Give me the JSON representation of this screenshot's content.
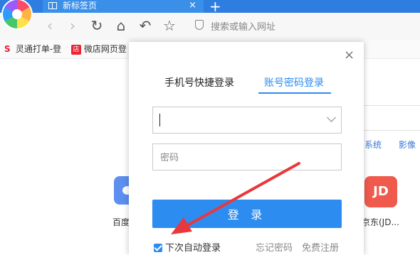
{
  "browser": {
    "tab_title": "新标签页",
    "tab_close": "×",
    "new_tab": "+",
    "address_placeholder": "搜索或输入网址",
    "bookmarks": [
      {
        "icon": "S",
        "label": "灵通打单-登"
      },
      {
        "icon": "店",
        "label": "微店网页登"
      }
    ]
  },
  "background": {
    "links": [
      "系统",
      "影像"
    ],
    "tiles": [
      {
        "label": "百度",
        "icon": "baidu-paw-icon"
      },
      {
        "label": "京东(JD...",
        "icon": "JD"
      }
    ]
  },
  "dialog": {
    "close": "×",
    "tabs": [
      "手机号快捷登录",
      "账号密码登录"
    ],
    "active_tab": "账号密码登录",
    "account_value": "",
    "password_placeholder": "密码",
    "login_button": "登 录",
    "auto_login": "下次自动登录",
    "auto_login_checked": true,
    "forgot_password": "忘记密码",
    "register": "免费注册"
  },
  "colors": {
    "accent": "#2d8cf0",
    "tab_bar": "#2e7de0",
    "annotation_arrow": "#e8383d"
  }
}
